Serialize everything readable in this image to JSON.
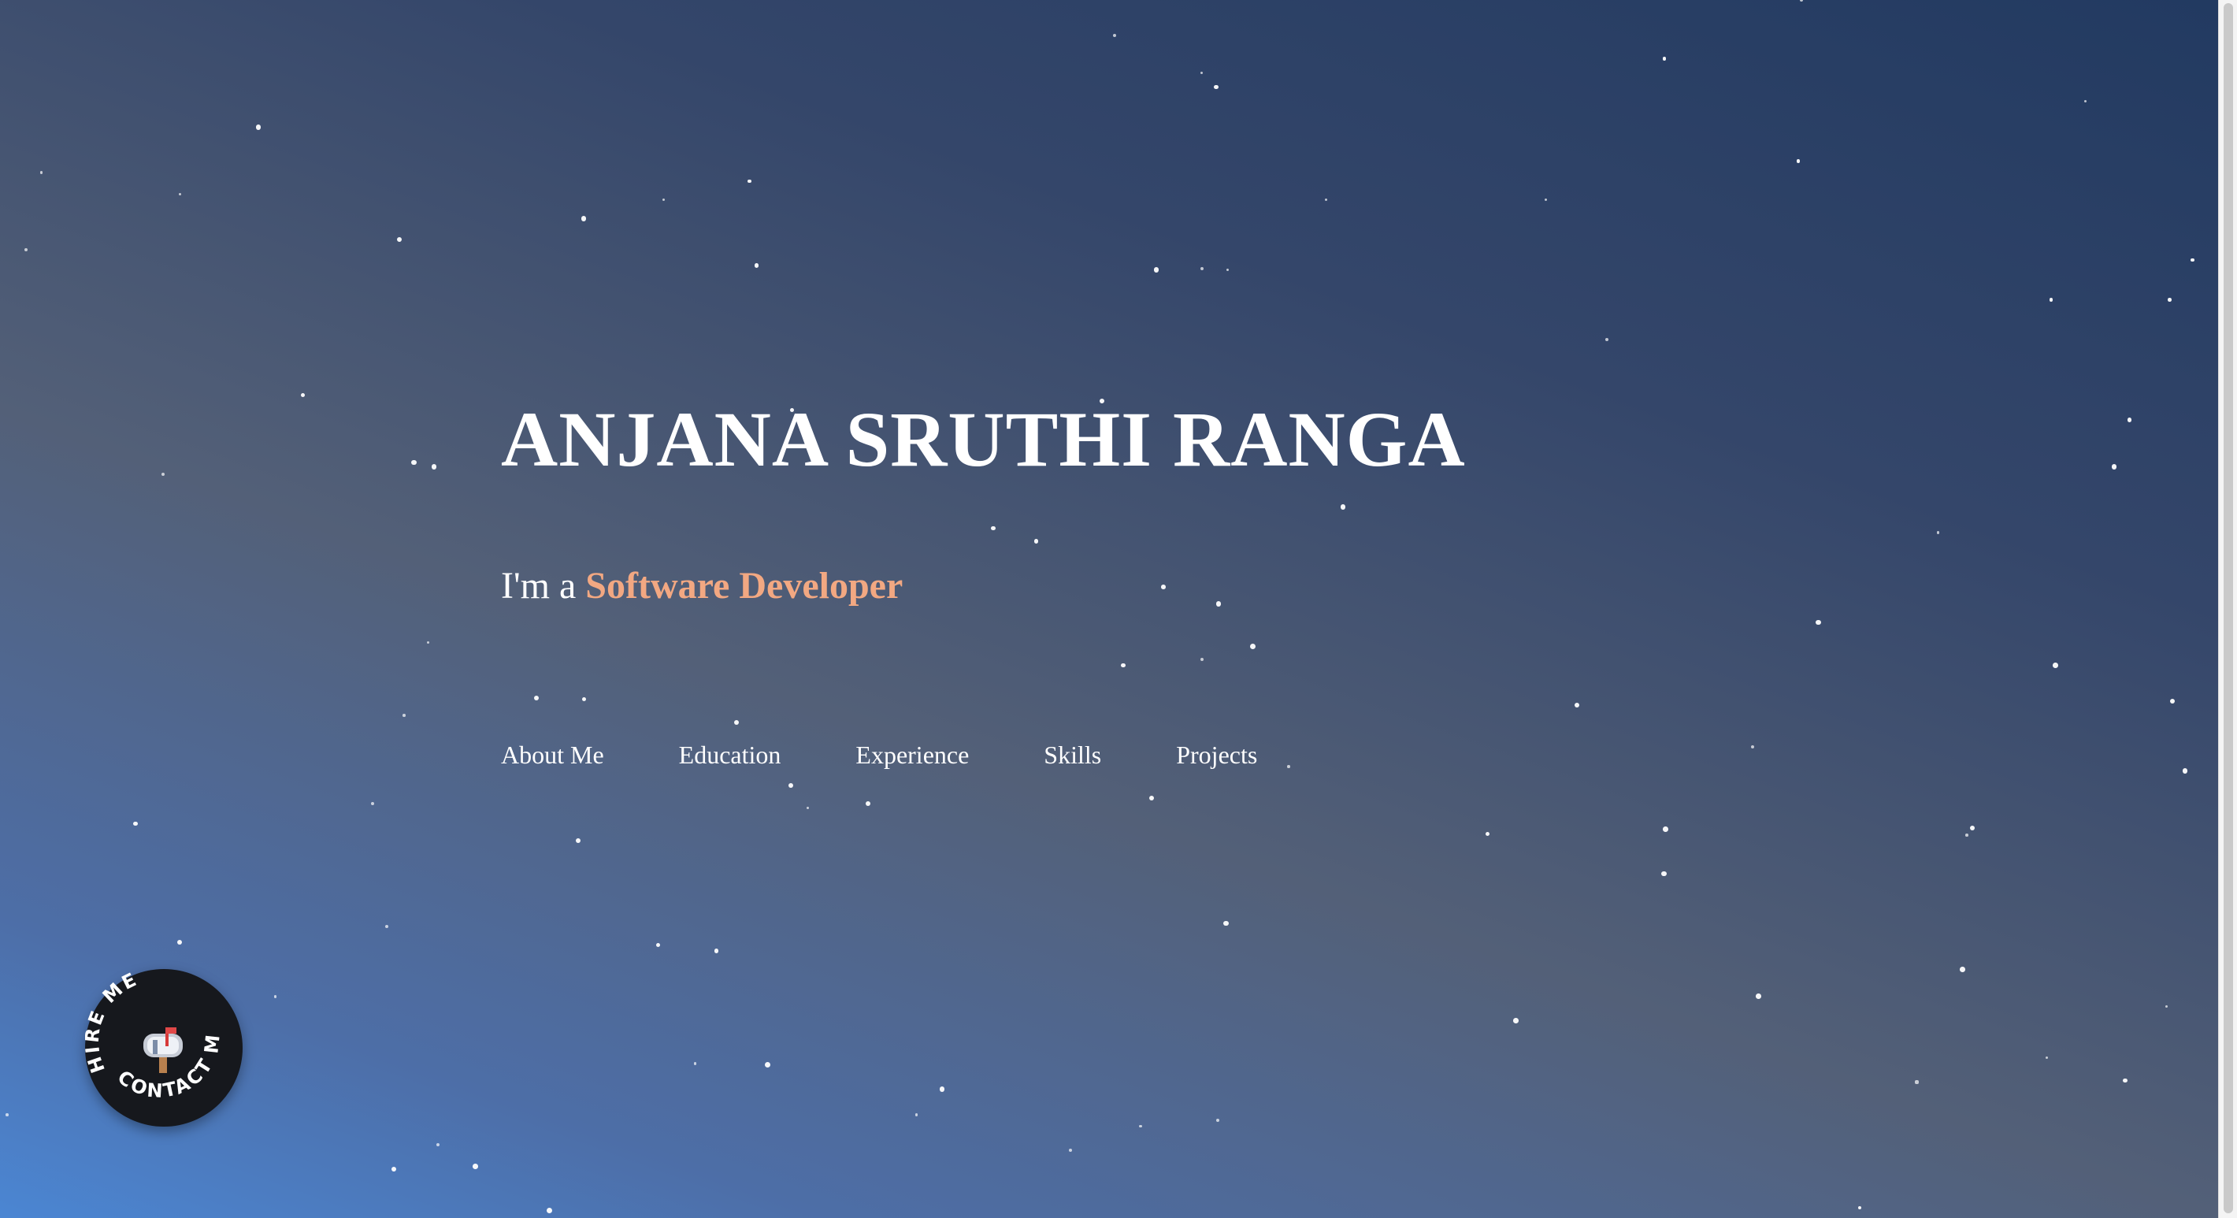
{
  "hero": {
    "title": "ANJANA SRUTHI RANGA",
    "tagline_prefix": "I'm a ",
    "tagline_role": "Software Developer"
  },
  "nav": {
    "items": [
      {
        "label": "About Me"
      },
      {
        "label": "Education"
      },
      {
        "label": "Experience"
      },
      {
        "label": "Skills"
      },
      {
        "label": "Projects"
      }
    ]
  },
  "contact_badge": {
    "text_top": "HIRE ME",
    "text_bottom": "CONTACT ME",
    "icon": "mailbox-icon"
  },
  "colors": {
    "background_top": "#223a61",
    "background_bottom": "#4b86d3",
    "accent": "#f2a882",
    "text": "#ffffff",
    "badge": "#16181d"
  }
}
